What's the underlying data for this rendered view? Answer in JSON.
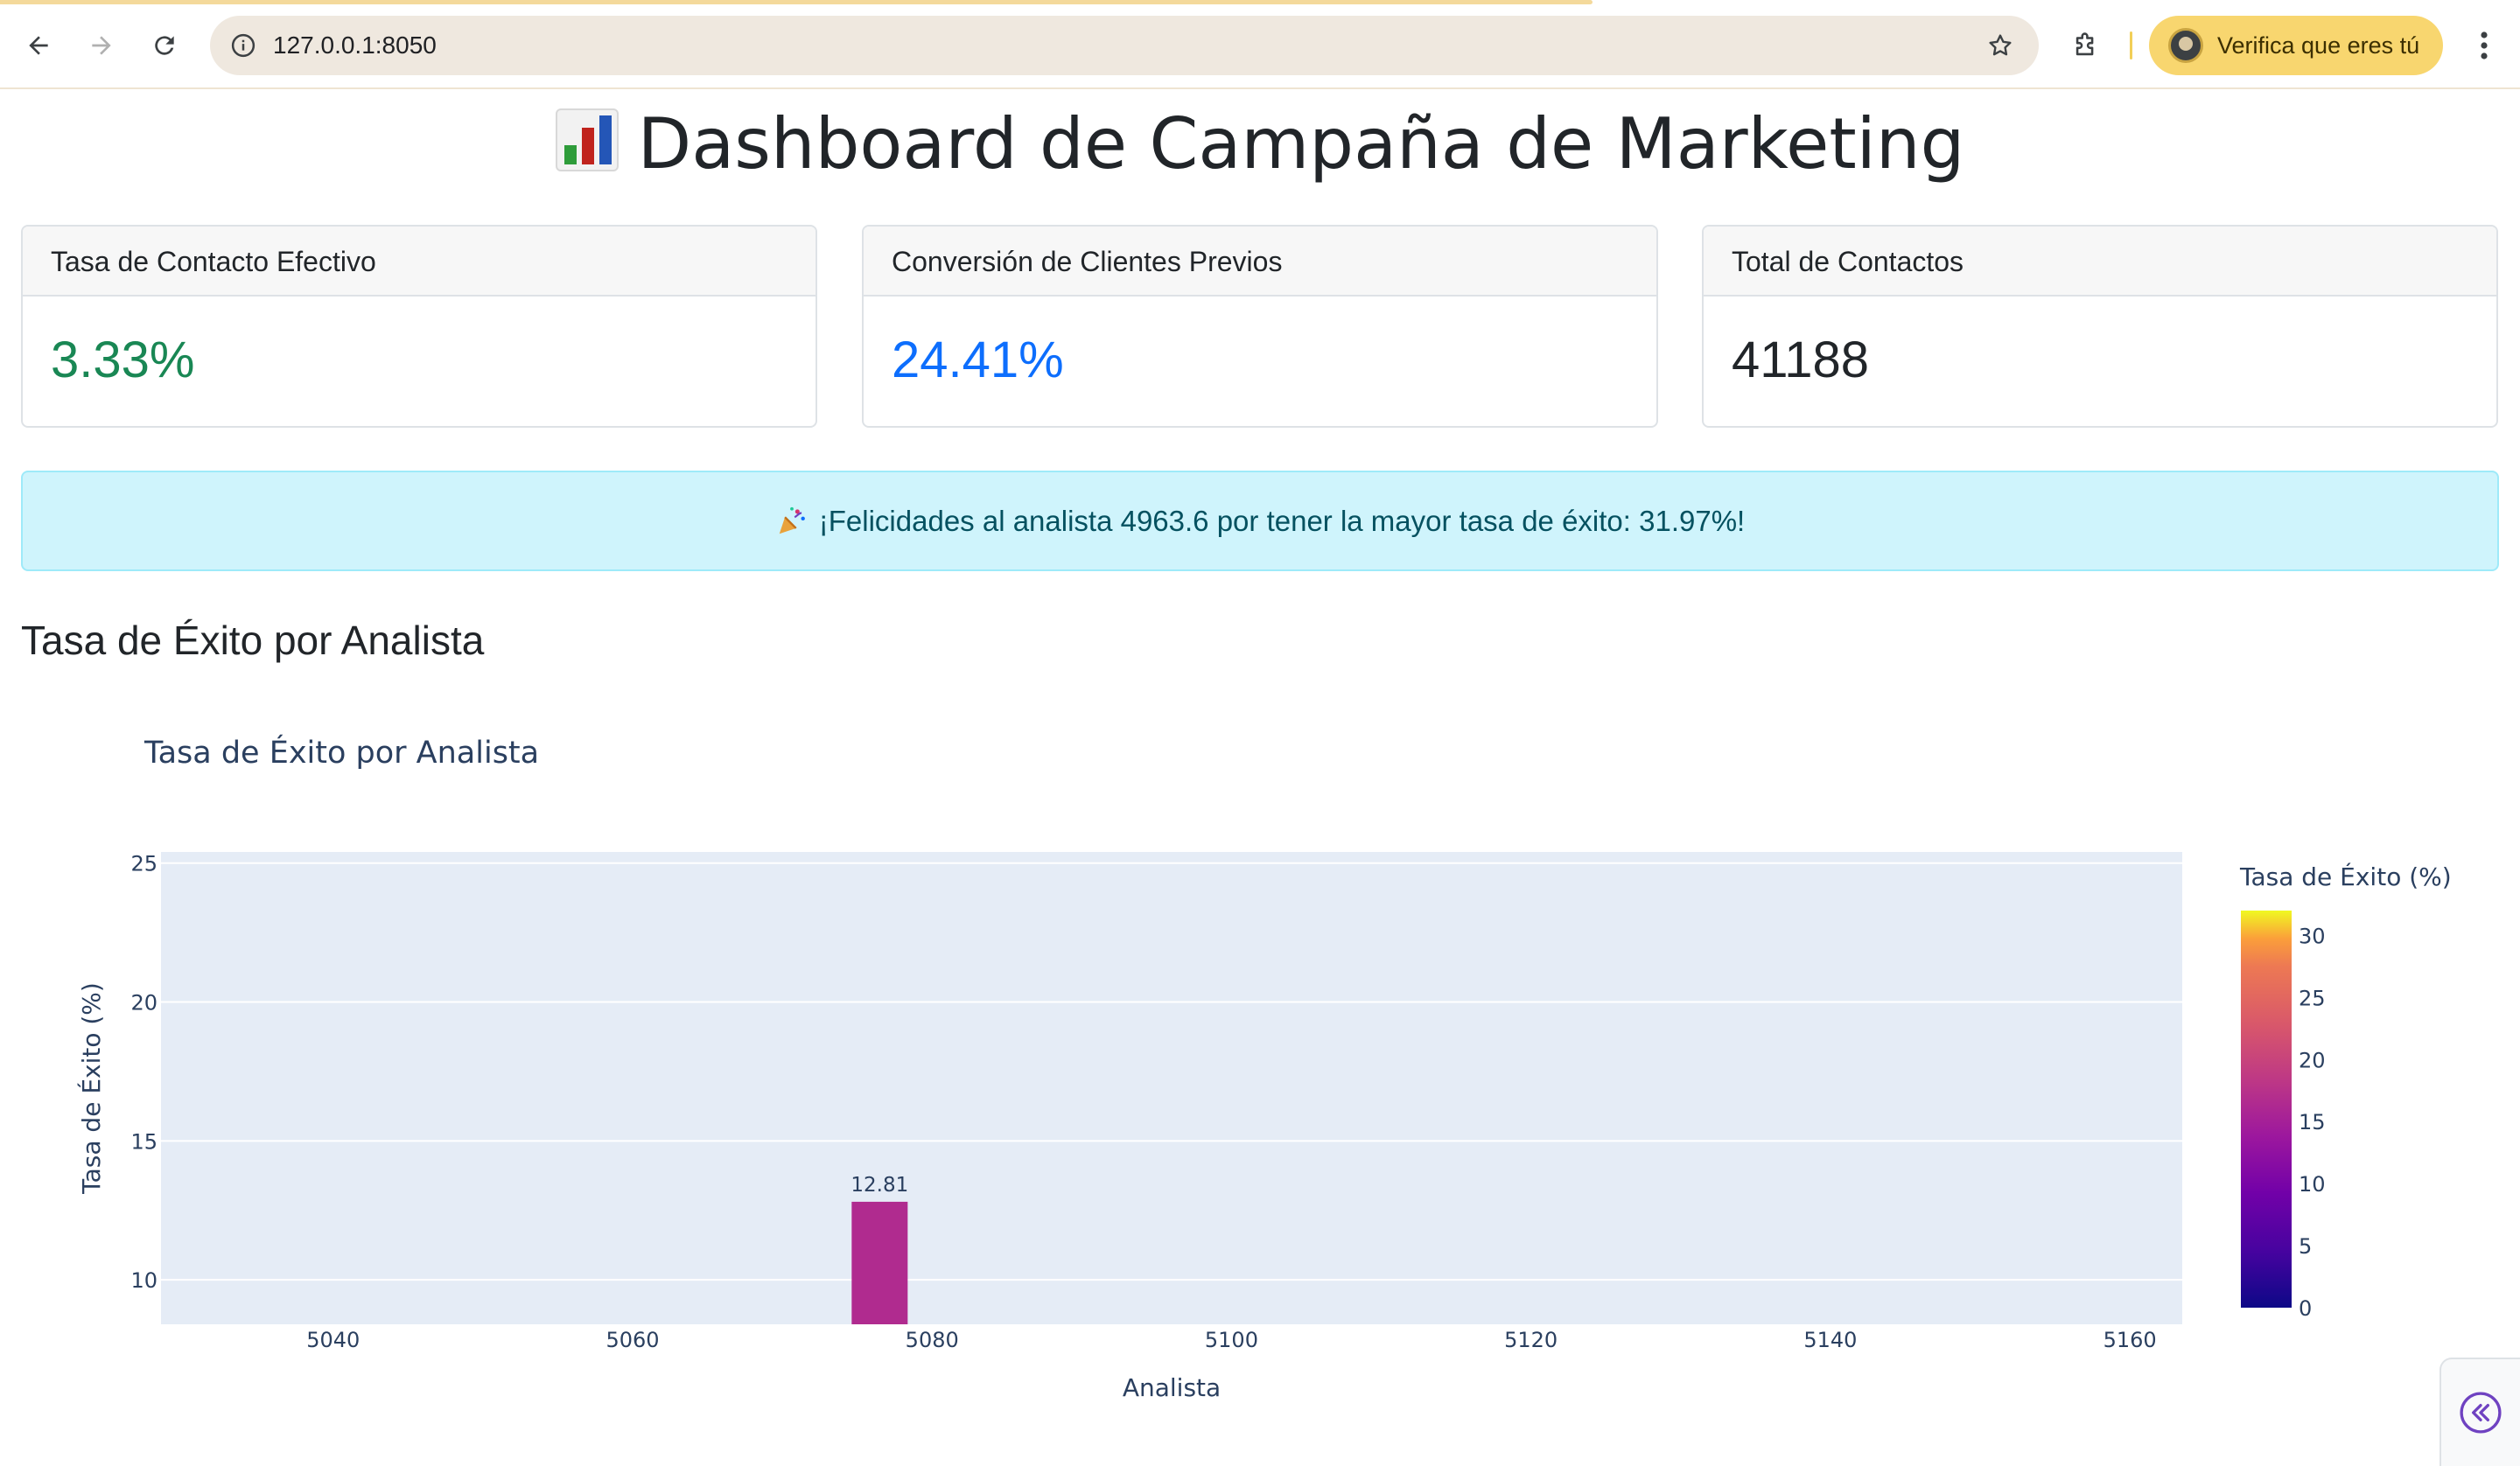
{
  "browser": {
    "url": "127.0.0.1:8050",
    "profile_label": "Verifica que eres tú",
    "icons": [
      "back-arrow-icon",
      "forward-arrow-icon",
      "reload-icon",
      "site-info-icon",
      "bookmark-star-icon",
      "extensions-puzzle-icon",
      "kebab-menu-icon"
    ]
  },
  "header": {
    "title": "Dashboard de Campaña de Marketing",
    "icon": "bar-chart-icon"
  },
  "kpis": [
    {
      "label": "Tasa de Contacto Efectivo",
      "value": "3.33%",
      "color": "#198754"
    },
    {
      "label": "Conversión de Clientes Previos",
      "value": "24.41%",
      "color": "#0d6efd"
    },
    {
      "label": "Total de Contactos",
      "value": "41188",
      "color": "#212529"
    }
  ],
  "alert": {
    "icon": "party-popper-icon",
    "text": "¡Felicidades al analista 4963.6 por tener la mayor tasa de éxito: 31.97%!"
  },
  "section": {
    "title": "Tasa de Éxito por Analista"
  },
  "chart_data": {
    "type": "bar",
    "title": "Tasa de Éxito por Analista",
    "xlabel": "Analista",
    "ylabel": "Tasa de Éxito (%)",
    "x_ticks": [
      5040,
      5060,
      5080,
      5100,
      5120,
      5140,
      5160
    ],
    "y_ticks": [
      10,
      15,
      20,
      25
    ],
    "xlim": [
      5028.5,
      5163.5
    ],
    "ylim": [
      8.4,
      25.4
    ],
    "bars": [
      {
        "x": 5076.5,
        "value": 12.81,
        "label": "12.81"
      }
    ],
    "colorbar": {
      "title": "Tasa de Éxito (%)",
      "colorscale": "plasma",
      "range": [
        0,
        32
      ],
      "ticks": [
        0,
        5,
        10,
        15,
        20,
        25,
        30
      ]
    },
    "colors": {
      "plot_bg": "#e5ecf6",
      "bar": "#b02b8f",
      "text": "#2a3f5f"
    }
  }
}
